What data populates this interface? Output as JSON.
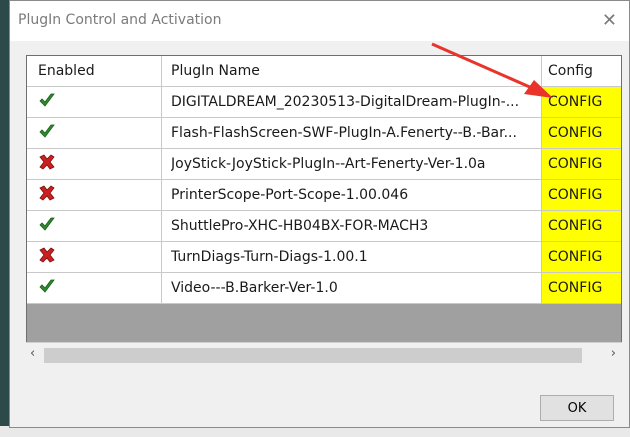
{
  "window": {
    "title": "PlugIn Control and Activation"
  },
  "columns": [
    "Enabled",
    "PlugIn Name",
    "Config"
  ],
  "rows": [
    {
      "enabled": "check",
      "name": "DIGITALDREAM_20230513-DigitalDream-PlugIn-...",
      "config": "CONFIG"
    },
    {
      "enabled": "check",
      "name": "Flash-FlashScreen-SWF-PlugIn-A.Fenerty--B.-Bar...",
      "config": "CONFIG"
    },
    {
      "enabled": "cross",
      "name": "JoyStick-JoyStick-PlugIn--Art-Fenerty-Ver-1.0a",
      "config": "CONFIG"
    },
    {
      "enabled": "cross",
      "name": "PrinterScope-Port-Scope-1.00.046",
      "config": "CONFIG"
    },
    {
      "enabled": "check",
      "name": "ShuttlePro-XHC-HB04BX-FOR-MACH3",
      "config": "CONFIG"
    },
    {
      "enabled": "cross",
      "name": "TurnDiags-Turn-Diags-1.00.1",
      "config": "CONFIG"
    },
    {
      "enabled": "check",
      "name": "Video---B.Barker-Ver-1.0",
      "config": "CONFIG"
    }
  ],
  "buttons": {
    "ok": "OK"
  },
  "icons": {
    "close": "close-icon",
    "enabled": "check-icon",
    "disabled": "cross-icon",
    "scroll_left": "chevron-left-icon",
    "scroll_right": "chevron-right-icon"
  },
  "colors": {
    "config_bg": "#ffff00",
    "enabled_green": "#2e8b2e",
    "disabled_red": "#cc1f1f",
    "annotation_arrow": "#e8342a"
  }
}
